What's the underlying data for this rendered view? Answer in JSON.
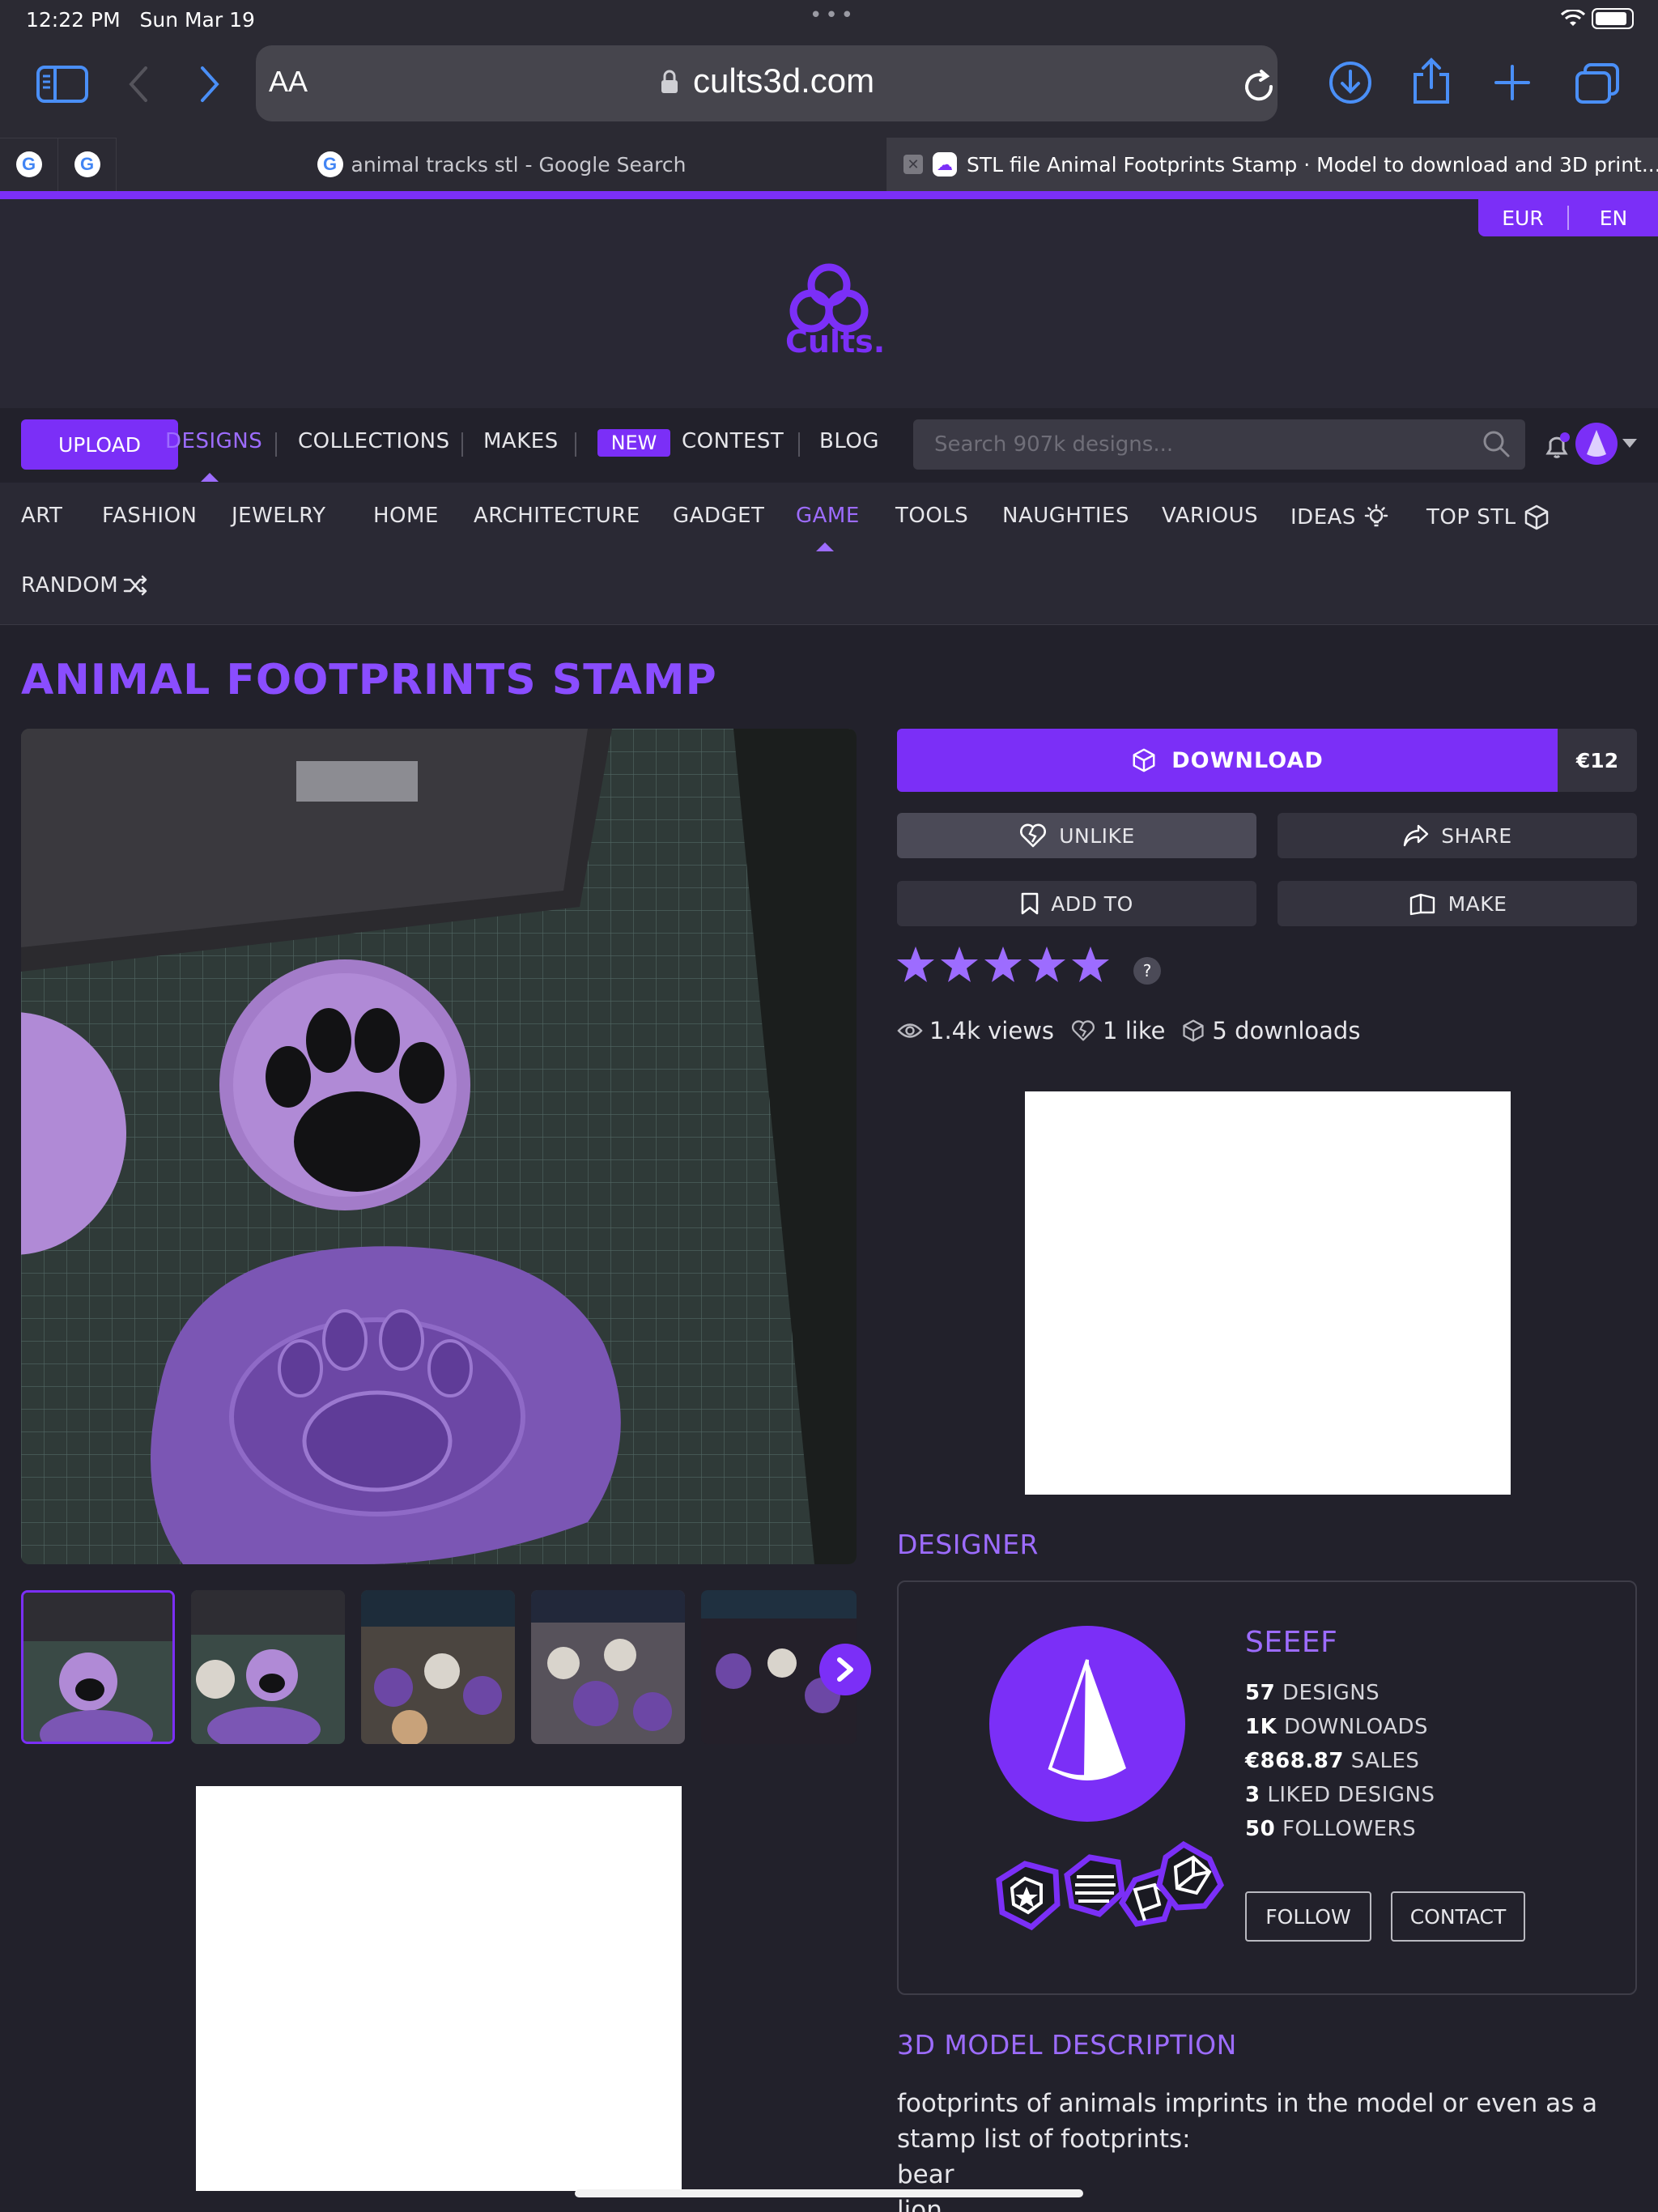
{
  "status_bar": {
    "time": "12:22 PM",
    "date": "Sun Mar 19"
  },
  "browser": {
    "aa_label": "AA",
    "url": "cults3d.com",
    "tabs": [
      {
        "title": "animal tracks stl - Google Search"
      },
      {
        "title": "STL file Animal Footprints Stamp · Model to download and 3D print..."
      }
    ],
    "google_favicon": "G"
  },
  "header": {
    "currency": "EUR",
    "language": "EN",
    "logo_text": "Cults."
  },
  "main_nav": {
    "upload": "UPLOAD",
    "designs": "DESIGNS",
    "collections": "COLLECTIONS",
    "makes": "MAKES",
    "new_badge": "NEW",
    "contest": "CONTEST",
    "blog": "BLOG",
    "search_placeholder": "Search 907k designs..."
  },
  "categories": [
    "ART",
    "FASHION",
    "JEWELRY",
    "HOME",
    "ARCHITECTURE",
    "GADGET",
    "GAME",
    "TOOLS",
    "NAUGHTIES",
    "VARIOUS",
    "IDEAS",
    "TOP STL",
    "RANDOM"
  ],
  "design": {
    "title": "ANIMAL FOOTPRINTS STAMP",
    "download_label": "DOWNLOAD",
    "price": "€12",
    "unlike_label": "UNLIKE",
    "share_label": "SHARE",
    "add_to_label": "ADD TO",
    "make_label": "MAKE",
    "rating_stars": 5,
    "rating_help": "?",
    "views": "1.4k views",
    "likes": "1 like",
    "downloads": "5 downloads"
  },
  "designer": {
    "heading": "DESIGNER",
    "name": "SEEEF",
    "designs_count": "57",
    "designs_label": "DESIGNS",
    "downloads_count": "1K",
    "downloads_label": "DOWNLOADS",
    "sales_amount": "€868.87",
    "sales_label": "SALES",
    "liked_count": "3",
    "liked_label": "LIKED DESIGNS",
    "followers_count": "50",
    "followers_label": "FOLLOWERS",
    "follow_label": "FOLLOW",
    "contact_label": "CONTACT"
  },
  "description": {
    "heading": "3D MODEL DESCRIPTION",
    "intro": "footprints of animals imprints in the model or even as a stamp list of footprints:",
    "items": [
      "bear",
      "lion"
    ]
  },
  "colors": {
    "accent": "#7b2ff7",
    "accent_light": "#9d6cff",
    "background": "#22212b",
    "safari_blue": "#4a8ff7"
  }
}
